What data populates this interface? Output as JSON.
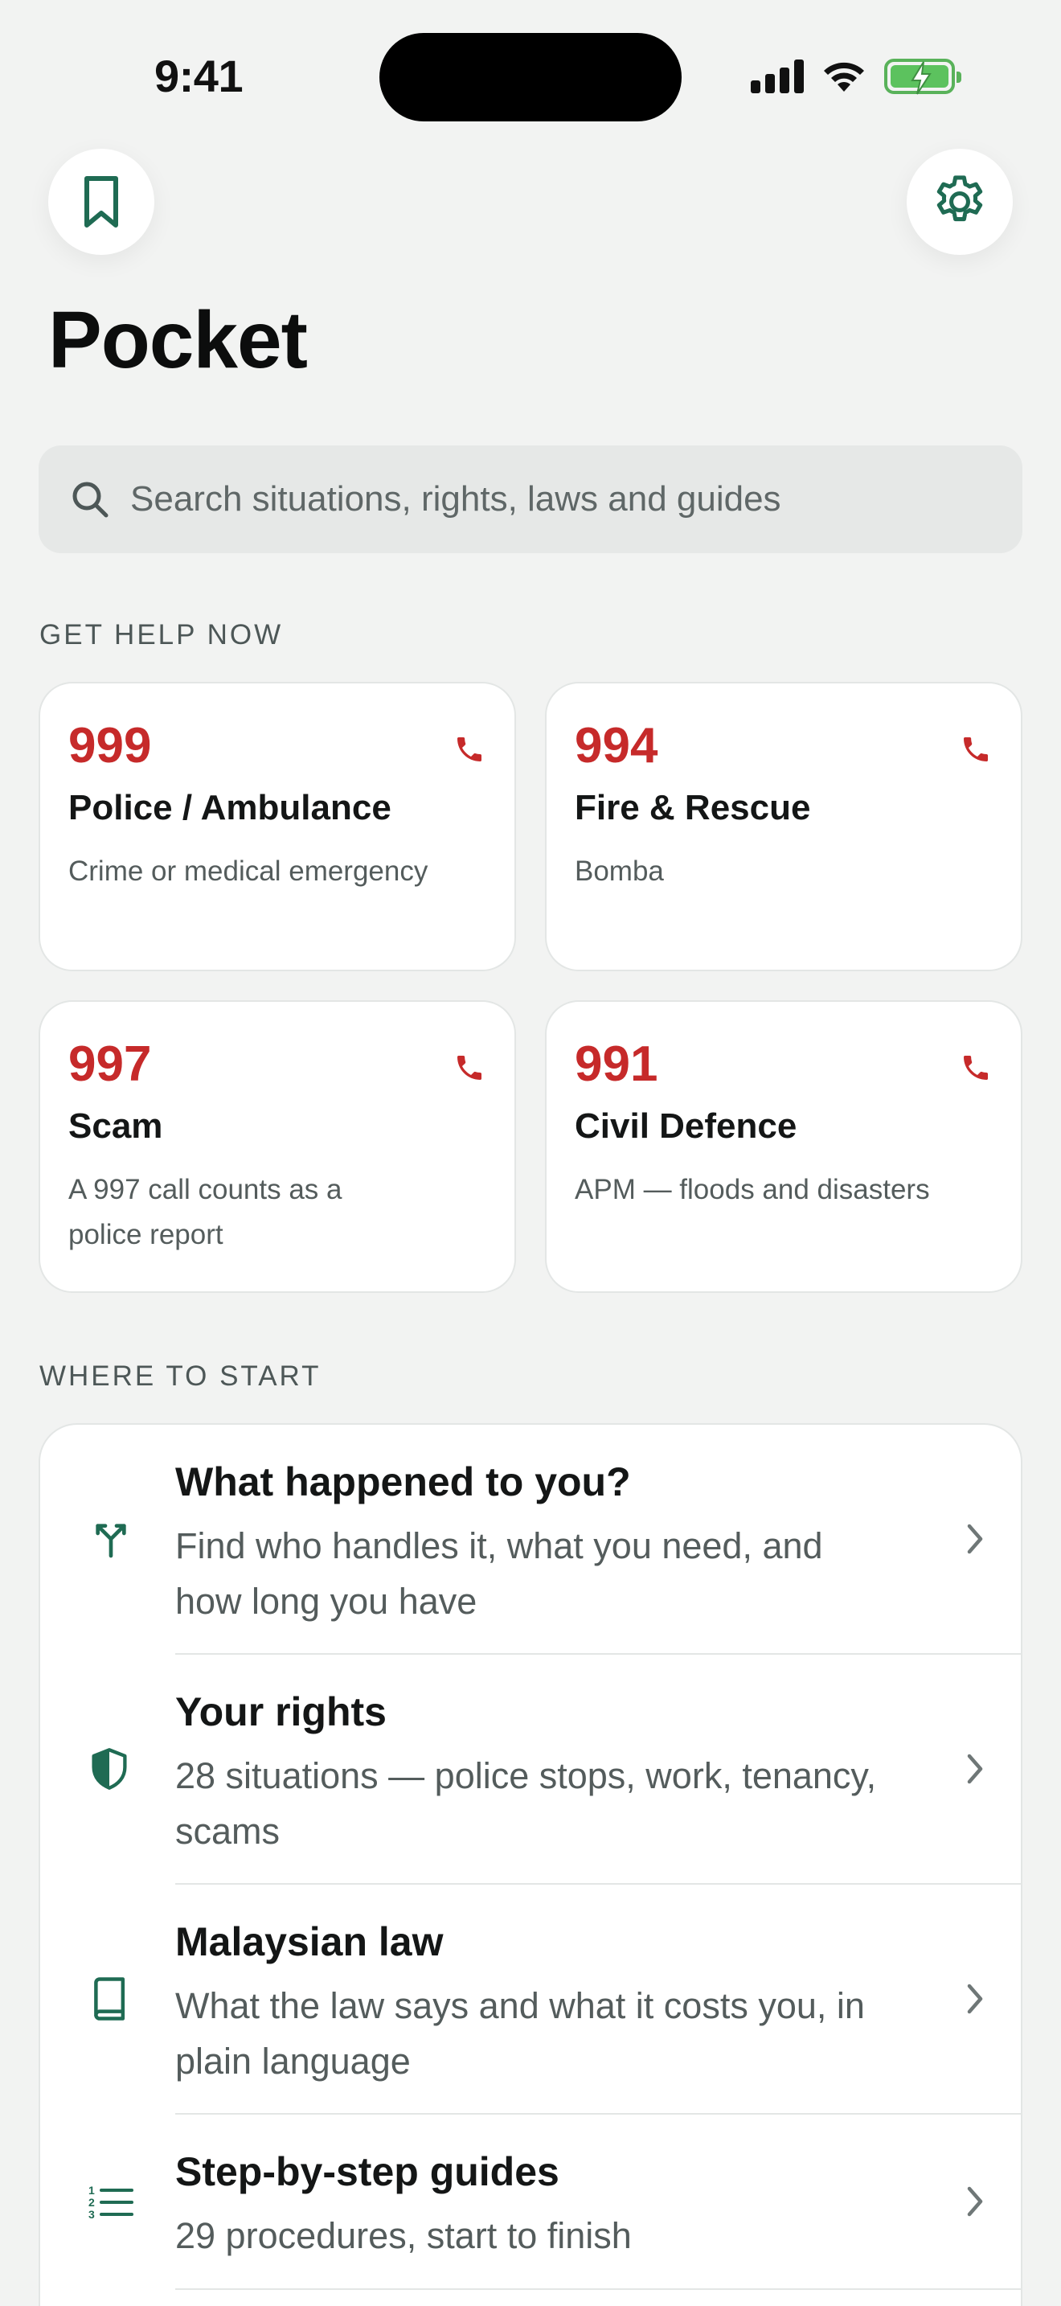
{
  "status_bar": {
    "time": "9:41",
    "icons": [
      "signal-icon",
      "wifi-icon",
      "battery-charging-icon"
    ]
  },
  "header": {
    "title": "Pocket",
    "left_icon": "bookmark-icon",
    "right_icon": "gear-icon"
  },
  "search": {
    "placeholder": "Search situations, rights, laws and guides"
  },
  "help_section": {
    "label": "GET HELP NOW",
    "cards": [
      {
        "number": "999",
        "title": "Police / Ambulance",
        "description": "Crime or medical emergency"
      },
      {
        "number": "994",
        "title": "Fire & Rescue",
        "description": "Bomba"
      },
      {
        "number": "997",
        "title": "Scam",
        "description": "A 997 call counts as a police report"
      },
      {
        "number": "991",
        "title": "Civil Defence",
        "description": "APM — floods and disasters"
      }
    ]
  },
  "start_section": {
    "label": "WHERE TO START",
    "items": [
      {
        "icon": "split-arrows-icon",
        "title": "What happened to you?",
        "subtitle": "Find who handles it, what you need, and how long you have"
      },
      {
        "icon": "shield-icon",
        "title": "Your rights",
        "subtitle": "28 situations — police stops, work, tenancy, scams"
      },
      {
        "icon": "book-icon",
        "title": "Malaysian law",
        "subtitle": "What the law says and what it costs you, in plain language"
      },
      {
        "icon": "numbered-list-icon",
        "title": "Step-by-step guides",
        "subtitle": "29 procedures, start to finish"
      }
    ]
  },
  "colors": {
    "accent": "#1f6b53",
    "emergency": "#c62a2a",
    "background": "#f2f3f2"
  }
}
